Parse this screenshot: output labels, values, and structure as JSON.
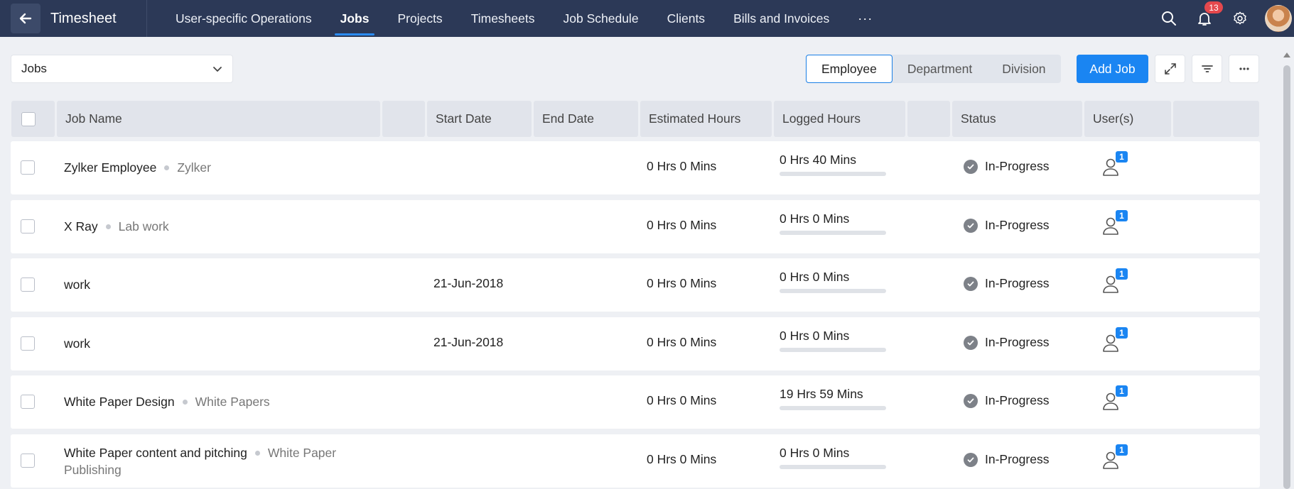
{
  "header": {
    "title": "Timesheet",
    "nav": [
      {
        "label": "User-specific Operations",
        "active": false
      },
      {
        "label": "Jobs",
        "active": true
      },
      {
        "label": "Projects",
        "active": false
      },
      {
        "label": "Timesheets",
        "active": false
      },
      {
        "label": "Job Schedule",
        "active": false
      },
      {
        "label": "Clients",
        "active": false
      },
      {
        "label": "Bills and Invoices",
        "active": false
      }
    ],
    "more": "···",
    "notification_count": "13",
    "icons": [
      "back-arrow-icon",
      "search-icon",
      "bell-icon",
      "gear-icon"
    ]
  },
  "toolbar": {
    "view_select": "Jobs",
    "segments": [
      {
        "label": "Employee",
        "active": true
      },
      {
        "label": "Department",
        "active": false
      },
      {
        "label": "Division",
        "active": false
      }
    ],
    "add_job_label": "Add Job",
    "tool_icons": [
      "expand-icon",
      "filter-icon",
      "more-icon"
    ]
  },
  "table": {
    "columns": [
      "Job Name",
      "",
      "Start Date",
      "End Date",
      "Estimated Hours",
      "Logged Hours",
      "",
      "Status",
      "User(s)",
      ""
    ],
    "rows": [
      {
        "name": "Zylker Employee",
        "sub": "Zylker",
        "start": "",
        "end": "",
        "estimated": "0 Hrs 0 Mins",
        "logged": "0 Hrs 40 Mins",
        "progress": 0,
        "status": "In-Progress",
        "users": "1"
      },
      {
        "name": "X Ray",
        "sub": "Lab work",
        "start": "",
        "end": "",
        "estimated": "0 Hrs 0 Mins",
        "logged": "0 Hrs 0 Mins",
        "progress": 0,
        "status": "In-Progress",
        "users": "1"
      },
      {
        "name": "work",
        "sub": "",
        "start": "21-Jun-2018",
        "end": "",
        "estimated": "0 Hrs 0 Mins",
        "logged": "0 Hrs 0 Mins",
        "progress": 0,
        "status": "In-Progress",
        "users": "1"
      },
      {
        "name": "work",
        "sub": "",
        "start": "21-Jun-2018",
        "end": "",
        "estimated": "0 Hrs 0 Mins",
        "logged": "0 Hrs 0 Mins",
        "progress": 0,
        "status": "In-Progress",
        "users": "1"
      },
      {
        "name": "White Paper Design",
        "sub": "White Papers",
        "start": "",
        "end": "",
        "estimated": "0 Hrs 0 Mins",
        "logged": "19 Hrs 59 Mins",
        "progress": 0,
        "status": "In-Progress",
        "users": "1"
      },
      {
        "name": "White Paper content and pitching",
        "sub": "White Paper Publishing",
        "start": "",
        "end": "",
        "estimated": "0 Hrs 0 Mins",
        "logged": "0 Hrs 0 Mins",
        "progress": 0,
        "status": "In-Progress",
        "users": "1"
      }
    ]
  },
  "colors": {
    "topbar": "#2c3957",
    "accent": "#1a85f2",
    "badge": "#e5484d",
    "status_icon": "#7d8188"
  }
}
